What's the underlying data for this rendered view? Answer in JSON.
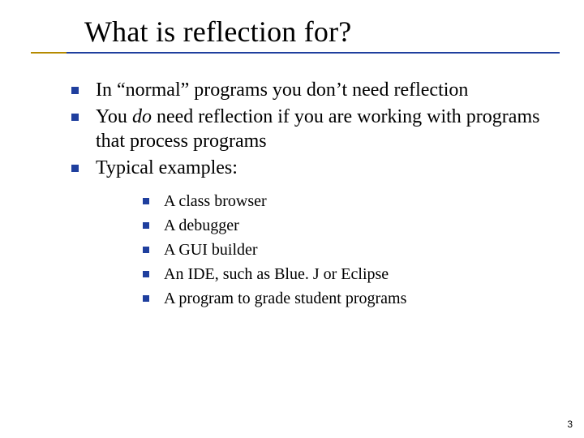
{
  "title": "What is reflection for?",
  "bullets": {
    "b1": "In “normal” programs you don’t need reflection",
    "b2_pre": "You ",
    "b2_em": "do",
    "b2_post": " need reflection if you are working with programs that process programs",
    "b3": "Typical examples:"
  },
  "sub": {
    "s1": "A class browser",
    "s2": "A debugger",
    "s3": "A GUI builder",
    "s4": "An IDE, such as Blue. J or Eclipse",
    "s5": "A program to grade student programs"
  },
  "page_number": "3"
}
